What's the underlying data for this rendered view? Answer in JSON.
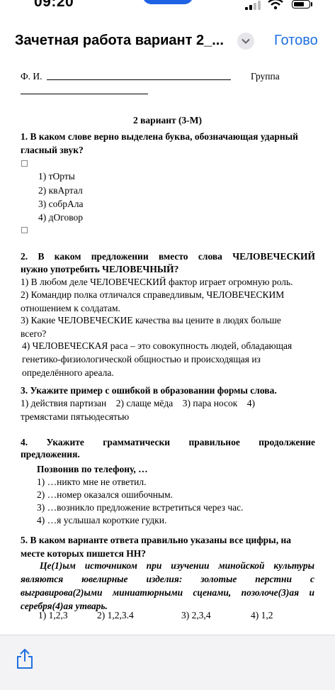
{
  "status_bar": {
    "time": "09:20"
  },
  "navbar": {
    "title": "Зачетная работа вариант 2_...",
    "done_label": "Готово"
  },
  "doc": {
    "fio_label": "Ф. И.",
    "group_label": "Группа",
    "variant": "2 вариант (3-М)",
    "q1": {
      "title": "1. В каком слове верно выделена буква, обозначающая ударный гласный звук?",
      "options": [
        "1) тОрты",
        "2) квАртал",
        "3) собрАла",
        "4) дОговор"
      ]
    },
    "q2": {
      "title_line1": "2.  В  каком  предложении  вместо  слова  ЧЕЛОВЕЧЕСКИЙ",
      "title_line2": "нужно употребить ЧЕЛОВЕЧНЫЙ?",
      "opt1": "1) В любом деле ЧЕЛОВЕЧЕСКИЙ фактор играет огромную роль.",
      "opt2": "2) Командир полка отличался справедливым, ЧЕЛОВЕЧЕСКИМ отношением к солдатам.",
      "opt3": "3) Какие ЧЕЛОВЕЧЕСКИЕ качества вы цените в людях больше всего?",
      "opt4": "4) ЧЕЛОВЕЧЕСКАЯ раса – это совокупность людей, обладающая генетико-физиологической общностью и происходящая из определённого ареала."
    },
    "q3": {
      "title": "3. Укажите пример с ошибкой в образовании формы слова.",
      "options": "1) действия партизан    2) слаще мёда    3) пара носок    4) тремястами пятьюдесятью"
    },
    "q4": {
      "title_line1": "4.    Укажите    грамматически    правильное    продолжение",
      "title_line2": "предложения.",
      "stem": "Позвонив по телефону, …",
      "options": [
        "1) …никто мне не ответил.",
        "2) …номер оказался ошибочным.",
        "3) …возникло предложение встретиться через час.",
        "4) …я услышал короткие гудки."
      ]
    },
    "q5": {
      "title": "5. В каком варианте ответа правильно указаны все цифры, на месте которых пишется НН?",
      "text": "Це(1)ым источником при изучении минойской культуры являются ювелирные изделия: золотые перстни с выгравирова(2)ыми миниатюрными сценами, позолоче(3)ая и серебря(4)ая утварь.",
      "options": [
        "1) 1,2,3",
        "2) 1,2,3.4",
        "3) 2,3,4",
        "4) 1,2"
      ]
    }
  },
  "bottom_bar": {
    "icon": "share-icon"
  },
  "colors": {
    "accent": "#1f6fe0",
    "bar": "#f3f3f5"
  }
}
